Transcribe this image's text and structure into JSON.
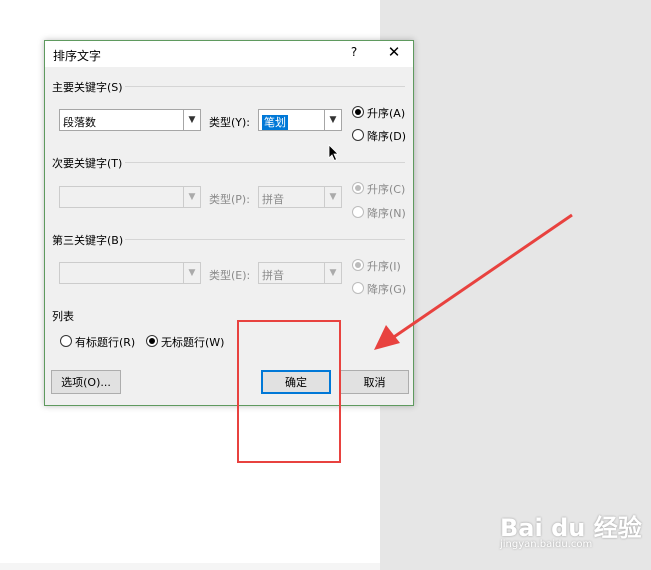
{
  "dialog": {
    "title": "排序文字",
    "help": "?",
    "close": "✕",
    "primary_key": {
      "label": "主要关键字(S)",
      "field_value": "段落数",
      "type_label": "类型(Y):",
      "type_value": "笔划",
      "asc_label": "升序(A)",
      "desc_label": "降序(D)",
      "order": "asc"
    },
    "secondary_key": {
      "label": "次要关键字(T)",
      "field_value": "",
      "type_label": "类型(P):",
      "type_value": "拼音",
      "asc_label": "升序(C)",
      "desc_label": "降序(N)",
      "order": "asc"
    },
    "third_key": {
      "label": "第三关键字(B)",
      "field_value": "",
      "type_label": "类型(E):",
      "type_value": "拼音",
      "asc_label": "升序(I)",
      "desc_label": "降序(G)",
      "order": "asc"
    },
    "list": {
      "label": "列表",
      "has_header_label": "有标题行(R)",
      "no_header_label": "无标题行(W)",
      "selected": "no_header"
    },
    "buttons": {
      "options": "选项(O)...",
      "ok": "确定",
      "cancel": "取消"
    }
  },
  "annotation": {
    "color": "#e8423f"
  },
  "watermark": {
    "brand": "Bai du 经验",
    "url": "jingyan.baidu.com"
  },
  "colors": {
    "accent": "#0078d7",
    "dialog_border": "#5f9a5f"
  }
}
